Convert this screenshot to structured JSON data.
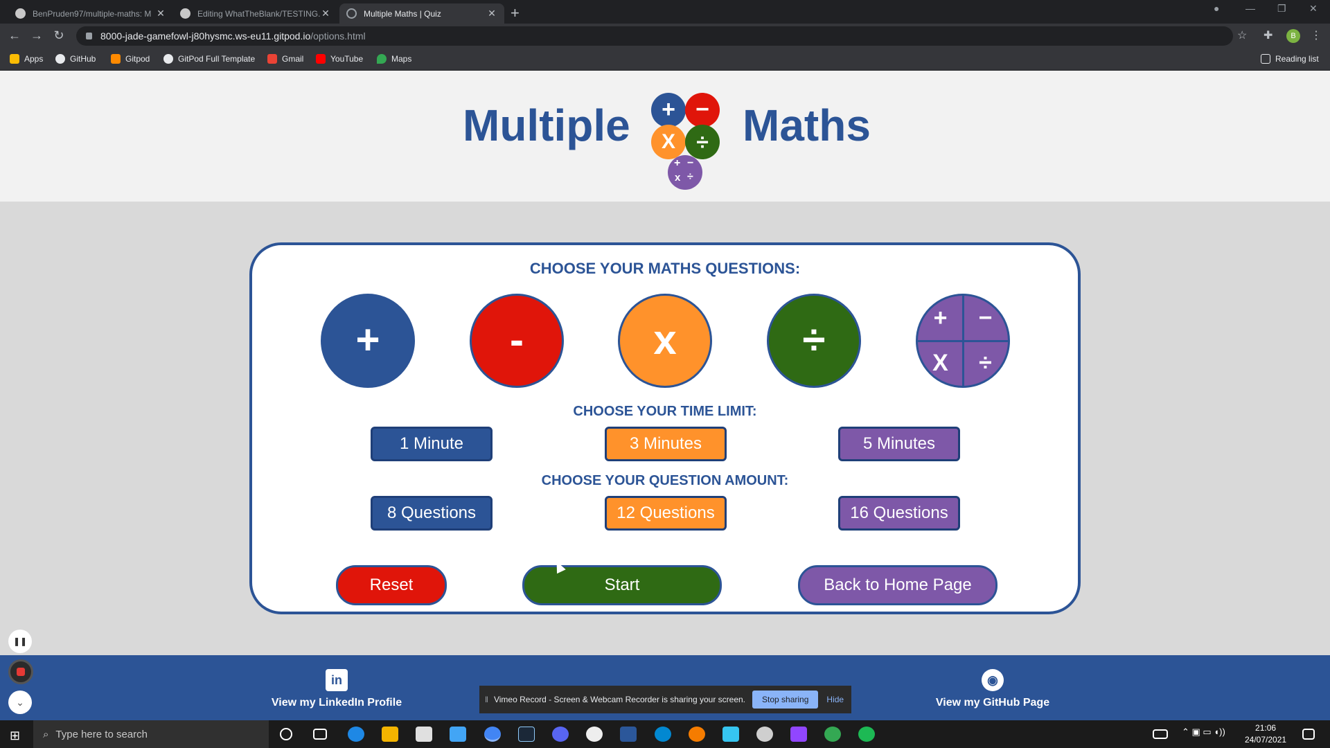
{
  "browser": {
    "tabs": [
      {
        "title": "BenPruden97/multiple-maths: M",
        "active": false
      },
      {
        "title": "Editing WhatTheBlank/TESTING.",
        "active": false
      },
      {
        "title": "Multiple Maths | Quiz",
        "active": true
      }
    ],
    "url_host": "8000-jade-gamefowl-j80hysmc.ws-eu11.gitpod.io",
    "url_path": "/options.html",
    "profile_initial": "B",
    "bookmarks": [
      "Apps",
      "GitHub",
      "Gitpod",
      "GitPod Full Template",
      "Gmail",
      "YouTube",
      "Maps"
    ],
    "reading_list": "Reading list"
  },
  "header": {
    "word_left": "Multiple",
    "word_right": "Maths",
    "logo": {
      "plus": "+",
      "minus": "−",
      "times": "X",
      "divide": "÷",
      "mini": [
        "+",
        "−",
        "x",
        "÷"
      ]
    }
  },
  "quiz": {
    "questions_heading": "CHOOSE YOUR MATHS QUESTIONS:",
    "operations": [
      {
        "symbol": "+",
        "color": "#2c5496"
      },
      {
        "symbol": "-",
        "color": "#e0150a"
      },
      {
        "symbol": "x",
        "color": "#ff922b"
      },
      {
        "symbol": "÷",
        "color": "#2f6a14"
      }
    ],
    "mixed": {
      "symbols": [
        "+",
        "−",
        "X",
        "÷"
      ],
      "color": "#7e58a8"
    },
    "time_heading": "CHOOSE YOUR TIME LIMIT:",
    "time_options": [
      "1 Minute",
      "3 Minutes",
      "5 Minutes"
    ],
    "amount_heading": "CHOOSE YOUR QUESTION AMOUNT:",
    "amount_options": [
      "8 Questions",
      "12 Questions",
      "16 Questions"
    ],
    "reset_label": "Reset",
    "start_label": "Start",
    "home_label": "Back to Home Page"
  },
  "footer": {
    "linkedin_label": "View my LinkedIn Profile",
    "github_label": "View my GitHub Page"
  },
  "sharebar": {
    "message": "Vimeo Record - Screen & Webcam Recorder is sharing your screen.",
    "stop_label": "Stop sharing",
    "hide_label": "Hide"
  },
  "taskbar": {
    "search_placeholder": "Type here to search",
    "time": "21:06",
    "date": "24/07/2021"
  },
  "colors": {
    "brand_blue": "#2c5496",
    "red": "#e0150a",
    "orange": "#ff922b",
    "green": "#2f6a14",
    "purple": "#7e58a8"
  }
}
